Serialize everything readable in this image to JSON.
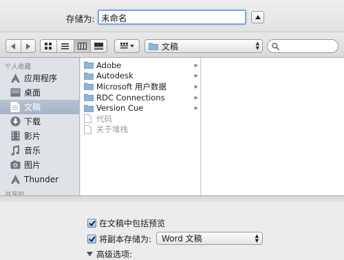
{
  "save_bar": {
    "label": "存储为:",
    "filename": "未命名"
  },
  "toolbar": {
    "current_folder": "文稿",
    "search_placeholder": ""
  },
  "sidebar": {
    "section_favorites": "个人收藏",
    "items": [
      {
        "label": "应用程序",
        "icon": "applications-icon",
        "selected": false
      },
      {
        "label": "桌面",
        "icon": "desktop-icon",
        "selected": false
      },
      {
        "label": "文稿",
        "icon": "documents-icon",
        "selected": true
      },
      {
        "label": "下载",
        "icon": "downloads-icon",
        "selected": false
      },
      {
        "label": "影片",
        "icon": "movies-icon",
        "selected": false
      },
      {
        "label": "音乐",
        "icon": "music-icon",
        "selected": false
      },
      {
        "label": "图片",
        "icon": "pictures-icon",
        "selected": false
      },
      {
        "label": "Thunder",
        "icon": "thunder-icon",
        "selected": false
      }
    ],
    "section_shared": "共享的"
  },
  "files": [
    {
      "name": "Adobe",
      "type": "folder",
      "dim": false
    },
    {
      "name": "Autodesk",
      "type": "folder",
      "dim": false
    },
    {
      "name": "Microsoft 用户数据",
      "type": "folder",
      "dim": false
    },
    {
      "name": "RDC Connections",
      "type": "folder",
      "dim": false
    },
    {
      "name": "Version Cue",
      "type": "folder",
      "dim": false
    },
    {
      "name": "代码",
      "type": "file",
      "dim": true
    },
    {
      "name": "关于堆栈",
      "type": "file",
      "dim": true
    }
  ],
  "options": {
    "include_preview_label": "在文稿中包括预览",
    "include_preview_checked": true,
    "save_copy_label": "将副本存储为:",
    "save_copy_checked": true,
    "format_value": "Word 文稿",
    "advanced_label": "高级选项:"
  },
  "colors": {
    "selection": "#a5b3c6",
    "focus_ring": "#7fa7df",
    "folder": "#8fb4dc"
  }
}
